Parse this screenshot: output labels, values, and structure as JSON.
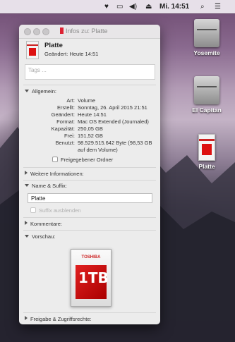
{
  "menubar": {
    "icons": [
      "heart-icon",
      "airplay-icon",
      "volume-icon",
      "eject-icon"
    ],
    "clock": "Mi. 14:51"
  },
  "desktop": {
    "icons": [
      {
        "label": "Yosemite"
      },
      {
        "label": "El Capitan"
      },
      {
        "label": "Platte"
      }
    ]
  },
  "window": {
    "title": "Infos zu: Platte",
    "header": {
      "name": "Platte",
      "modified": "Geändert: Heute 14:51"
    },
    "tags_placeholder": "Tags ...",
    "general": {
      "heading": "Allgemein:",
      "rows": [
        {
          "key": "Art:",
          "value": "Volume"
        },
        {
          "key": "Erstellt:",
          "value": "Sonntag, 26. April 2015 21:51"
        },
        {
          "key": "Geändert:",
          "value": "Heute 14:51"
        },
        {
          "key": "Format:",
          "value": "Mac OS Extended (Journaled)"
        },
        {
          "key": "Kapazität:",
          "value": "250,05 GB"
        },
        {
          "key": "Frei:",
          "value": "151,52 GB"
        },
        {
          "key": "Benutzt:",
          "value": "98.529.515.642 Byte (98,53 GB"
        },
        {
          "key": "",
          "value": "auf dem Volume)"
        }
      ],
      "shared_folder_label": "Freigegebener Ordner"
    },
    "more_info": "Weitere Informationen:",
    "name_ext": {
      "heading": "Name & Suffix:",
      "value": "Platte",
      "hide_ext_label": "Suffix ausblenden"
    },
    "comments": "Kommentare:",
    "preview": {
      "heading": "Vorschau:",
      "brand": "TOSHIBA",
      "size": "1TB"
    },
    "sharing": "Freigabe & Zugriffsrechte:"
  }
}
